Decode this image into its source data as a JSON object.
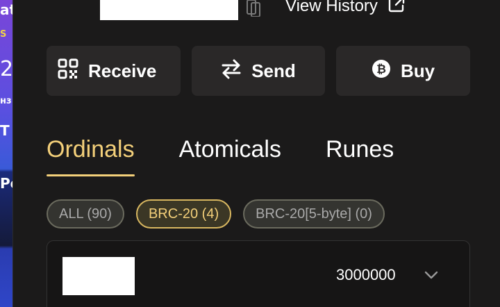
{
  "background_page": {
    "fragments": [
      "at",
      "S",
      "2 I",
      "нз",
      "T I",
      "Po"
    ]
  },
  "header": {
    "view_history_label": "View History"
  },
  "actions": {
    "receive_label": "Receive",
    "send_label": "Send",
    "buy_label": "Buy"
  },
  "tabs": [
    {
      "label": "Ordinals",
      "active": true
    },
    {
      "label": "Atomicals",
      "active": false
    },
    {
      "label": "Runes",
      "active": false
    }
  ],
  "filters": [
    {
      "label": "ALL (90)",
      "active": false
    },
    {
      "label": "BRC-20 (4)",
      "active": true
    },
    {
      "label": "BRC-20[5-byte] (0)",
      "active": false
    }
  ],
  "tokens": [
    {
      "amount": "3000000"
    }
  ],
  "colors": {
    "accent": "#f4d07a",
    "panel_bg": "#1b1a1a",
    "button_bg": "#2a2828"
  },
  "icons": {
    "copy": "copy-icon",
    "external_link": "external-link-icon",
    "receive": "qr-code-icon",
    "send": "swap-arrows-icon",
    "buy": "bitcoin-icon",
    "expand": "chevron-down-icon"
  }
}
